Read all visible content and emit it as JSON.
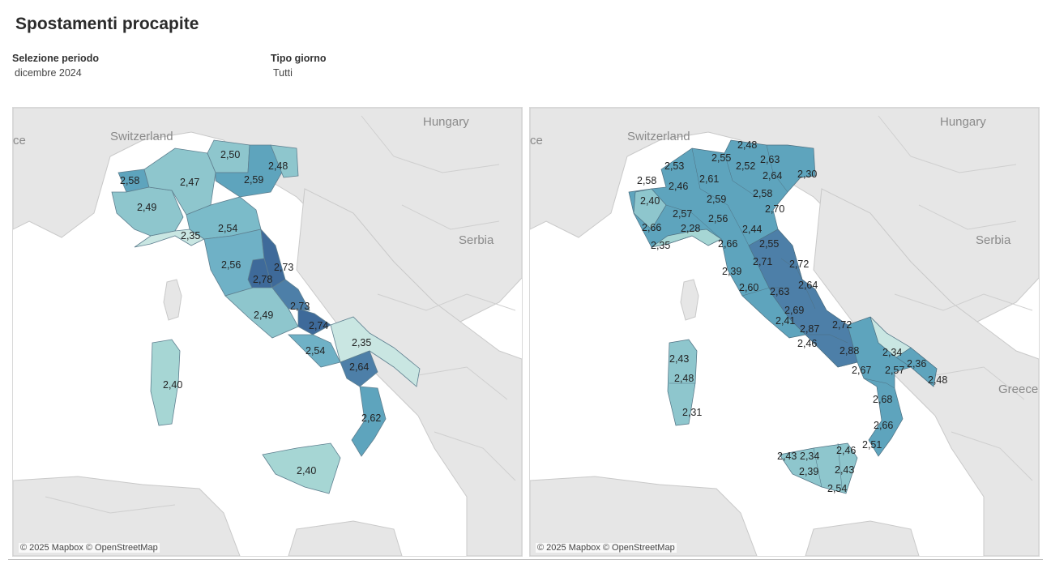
{
  "page": {
    "title": "Spostamenti procapite"
  },
  "filters": [
    {
      "label": "Selezione periodo",
      "value": "dicembre 2024"
    },
    {
      "label": "Tipo giorno",
      "value": "Tutti"
    }
  ],
  "attribution": "© 2025 Mapbox © OpenStreetMap",
  "colors": {
    "land": "#e6e6e6",
    "sea": "#ffffff",
    "scale_low": "#b9dfdb",
    "scale_high": "#3e6a9a"
  },
  "maps": [
    {
      "name": "regions",
      "countries": [
        "Switzerland",
        "Hungary",
        "Serbia",
        "Greece",
        "ce"
      ],
      "labels": [
        "2,58",
        "2,47",
        "2,50",
        "2,59",
        "2,48",
        "2,49",
        "2,35",
        "2,54",
        "2,56",
        "2,73",
        "2,78",
        "2,73",
        "2,74",
        "2,49",
        "2,35",
        "2,54",
        "2,64",
        "2,40",
        "2,62",
        "2,40"
      ]
    },
    {
      "name": "provinces",
      "countries": [
        "Switzerland",
        "Hungary",
        "Serbia",
        "Greece",
        "ce"
      ],
      "labels": [
        "2,48",
        "2,55",
        "2,63",
        "2,53",
        "2,61",
        "2,52",
        "2,64",
        "2,30",
        "2,58",
        "2,46",
        "2,59",
        "2,58",
        "2,40",
        "2,57",
        "2,56",
        "2,70",
        "2,66",
        "2,28",
        "2,44",
        "2,35",
        "2,66",
        "2,55",
        "2,71",
        "2,72",
        "2,39",
        "2,60",
        "2,63",
        "2,64",
        "2,69",
        "2,41",
        "2,87",
        "2,72",
        "2,46",
        "2,88",
        "2,34",
        "2,43",
        "2,67",
        "2,57",
        "2,36",
        "2,48",
        "2,48",
        "2,68",
        "2,31",
        "2,66",
        "2,51",
        "2,46",
        "2,43",
        "2,34",
        "2,43",
        "2,39",
        "2,54"
      ]
    }
  ]
}
